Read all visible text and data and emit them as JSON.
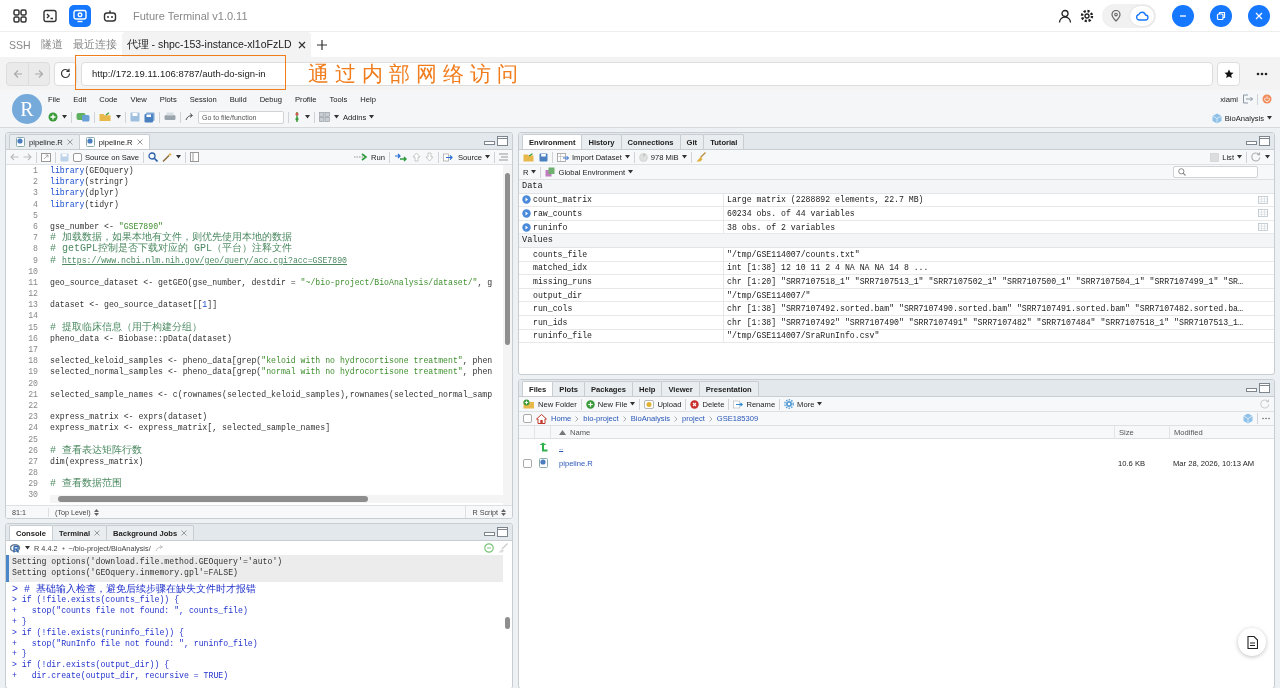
{
  "app": {
    "nav_icons": [
      {
        "kind": "grid",
        "selected": false
      },
      {
        "kind": "terminal",
        "selected": false
      },
      {
        "kind": "monitor",
        "selected": true
      },
      {
        "kind": "robot",
        "selected": false
      }
    ],
    "title": "Future Terminal v1.0.11",
    "mode_toggle": [
      {
        "kind": "pin",
        "selected": false
      },
      {
        "kind": "cloud",
        "selected": true
      }
    ]
  },
  "tabs": [
    {
      "label": "SSH",
      "selected": false,
      "closable": false
    },
    {
      "label": "隧道",
      "selected": false,
      "closable": false
    },
    {
      "label": "最近连接",
      "selected": false,
      "closable": false
    },
    {
      "label": "代理 - shpc-153-instance-xl1oFzLD",
      "selected": true,
      "closable": true
    }
  ],
  "address": {
    "url": "http://172.19.11.106:8787/auth-do-sign-in"
  },
  "annotation": {
    "text": "通过内部网络访问"
  },
  "rstudio": {
    "logo": "R",
    "menu": [
      "File",
      "Edit",
      "Code",
      "View",
      "Plots",
      "Session",
      "Build",
      "Debug",
      "Profile",
      "Tools",
      "Help"
    ],
    "goto_placeholder": "Go to file/function",
    "addins": "Addins",
    "user": "xiami",
    "project": "BioAnalysis"
  },
  "editor": {
    "tabs": [
      {
        "label": "pipeline.R",
        "selected": false
      },
      {
        "label": "pipeline.R",
        "selected": true
      }
    ],
    "source_on_save": {
      "label": "Source on Save",
      "checked": false
    },
    "run": "Run",
    "source": "Source",
    "lines": [
      {
        "n": "1",
        "segs": [
          {
            "kind": "fn",
            "text": "library"
          },
          {
            "kind": "plain",
            "text": "(GEOquery)"
          }
        ]
      },
      {
        "n": "2",
        "segs": [
          {
            "kind": "fn",
            "text": "library"
          },
          {
            "kind": "plain",
            "text": "(stringr)"
          }
        ]
      },
      {
        "n": "3",
        "segs": [
          {
            "kind": "fn",
            "text": "library"
          },
          {
            "kind": "plain",
            "text": "(dplyr)"
          }
        ]
      },
      {
        "n": "4",
        "segs": [
          {
            "kind": "fn",
            "text": "library"
          },
          {
            "kind": "plain",
            "text": "(tidyr)"
          }
        ]
      },
      {
        "n": "5"
      },
      {
        "n": "6",
        "segs": [
          {
            "kind": "plain",
            "text": "gse_number <- "
          },
          {
            "kind": "string",
            "text": "\"GSE7890\""
          }
        ]
      },
      {
        "n": "7",
        "segs": [
          {
            "kind": "comment",
            "text": "# 加载数据，如果本地有文件，则优先使用本地的数据"
          }
        ]
      },
      {
        "n": "8",
        "segs": [
          {
            "kind": "comment",
            "text": "# getGPL控制是否下载对应的 GPL（平台）注释文件"
          }
        ]
      },
      {
        "n": "9",
        "segs": [
          {
            "kind": "comment",
            "text": "# "
          },
          {
            "kind": "link",
            "text": "https://www.ncbi.nlm.nih.gov/geo/query/acc.cgi?acc=GSE7890"
          }
        ]
      },
      {
        "n": "10"
      },
      {
        "n": "11",
        "segs": [
          {
            "kind": "plain",
            "text": "geo_source_dataset <- getGEO(gse_number, destdir = "
          },
          {
            "kind": "string",
            "text": "\"~/bio-project/BioAnalysis/dataset/\""
          },
          {
            "kind": "plain",
            "text": ", g"
          }
        ]
      },
      {
        "n": "12"
      },
      {
        "n": "13",
        "segs": [
          {
            "kind": "plain",
            "text": "dataset <- geo_source_dataset[["
          },
          {
            "kind": "number",
            "text": "1"
          },
          {
            "kind": "plain",
            "text": "]]"
          }
        ]
      },
      {
        "n": "14"
      },
      {
        "n": "15",
        "segs": [
          {
            "kind": "comment",
            "text": "# 提取临床信息（用于构建分组）"
          }
        ]
      },
      {
        "n": "16",
        "segs": [
          {
            "kind": "plain",
            "text": "pheno_data <- Biobase::pData(dataset)"
          }
        ]
      },
      {
        "n": "17"
      },
      {
        "n": "18",
        "segs": [
          {
            "kind": "plain",
            "text": "selected_keloid_samples <- pheno_data[grep("
          },
          {
            "kind": "string",
            "text": "\"keloid with no hydrocortisone treatment\""
          },
          {
            "kind": "plain",
            "text": ", phen"
          }
        ]
      },
      {
        "n": "19",
        "segs": [
          {
            "kind": "plain",
            "text": "selected_normal_samples <- pheno_data[grep("
          },
          {
            "kind": "string",
            "text": "\"normal with no hydrocortisone treatment\""
          },
          {
            "kind": "plain",
            "text": ", phen"
          }
        ]
      },
      {
        "n": "20"
      },
      {
        "n": "21",
        "segs": [
          {
            "kind": "plain",
            "text": "selected_sample_names <- c(rownames(selected_keloid_samples),rownames(selected_normal_samp"
          }
        ]
      },
      {
        "n": "22"
      },
      {
        "n": "23",
        "segs": [
          {
            "kind": "plain",
            "text": "express_matrix <- exprs(dataset)"
          }
        ]
      },
      {
        "n": "24",
        "segs": [
          {
            "kind": "plain",
            "text": "express_matrix <- express_matrix[, selected_sample_names]"
          }
        ]
      },
      {
        "n": "25"
      },
      {
        "n": "26",
        "segs": [
          {
            "kind": "comment",
            "text": "# 查看表达矩阵行数"
          }
        ]
      },
      {
        "n": "27",
        "segs": [
          {
            "kind": "plain",
            "text": "dim(express_matrix)"
          }
        ]
      },
      {
        "n": "28"
      },
      {
        "n": "29",
        "segs": [
          {
            "kind": "comment",
            "text": "# 查看数据范围"
          }
        ]
      },
      {
        "n": "30"
      }
    ],
    "status": {
      "position": "81:1",
      "scope": "(Top Level)",
      "type": "R Script"
    }
  },
  "console": {
    "tabs": [
      {
        "label": "Console",
        "selected": true,
        "closable": false
      },
      {
        "label": "Terminal",
        "selected": false,
        "closable": true
      },
      {
        "label": "Background Jobs",
        "selected": false,
        "closable": true
      }
    ],
    "version": "R 4.4.2",
    "path": "~/bio-project/BioAnalysis/",
    "lines": [
      {
        "kind": "output",
        "text": "Setting options('download.file.method.GEOquery'='auto')"
      },
      {
        "kind": "output",
        "text": "Setting options('GEOquery.inmemory.gpl'=FALSE)"
      },
      {
        "kind": "comment",
        "text": "> # 基础输入检查，避免后续步骤在缺失文件时才报错"
      },
      {
        "kind": "input",
        "text": "> if (!file.exists(counts_file)) {"
      },
      {
        "kind": "input",
        "text": "+   stop(\"counts file not found: \", counts_file)"
      },
      {
        "kind": "input",
        "text": "+ }"
      },
      {
        "kind": "input",
        "text": "> if (!file.exists(runinfo_file)) {"
      },
      {
        "kind": "input",
        "text": "+   stop(\"RunInfo file not found: \", runinfo_file)"
      },
      {
        "kind": "input",
        "text": "+ }"
      },
      {
        "kind": "input",
        "text": "> if (!dir.exists(output_dir)) {"
      },
      {
        "kind": "input",
        "text": "+   dir.create(output_dir, recursive = TRUE)"
      }
    ]
  },
  "environment": {
    "tabs": [
      {
        "label": "Environment",
        "selected": true
      },
      {
        "label": "History",
        "selected": false
      },
      {
        "label": "Connections",
        "selected": false
      },
      {
        "label": "Git",
        "selected": false
      },
      {
        "label": "Tutorial",
        "selected": false
      }
    ],
    "import": "Import Dataset",
    "memory": "978 MiB",
    "view": "List",
    "language": "R",
    "scope": "Global Environment",
    "sections": [
      {
        "title": "Data",
        "rows": [
          {
            "kind": "data",
            "name": "count_matrix",
            "value": "Large matrix (2288892 elements, 22.7 MB)"
          },
          {
            "kind": "data",
            "name": "raw_counts",
            "value": "60234 obs. of 44 variables"
          },
          {
            "kind": "data",
            "name": "runinfo",
            "value": "38 obs. of 2 variables"
          }
        ]
      },
      {
        "title": "Values",
        "rows": [
          {
            "kind": "value",
            "name": "counts_file",
            "value": "\"/tmp/GSE114007/counts.txt\""
          },
          {
            "kind": "value",
            "name": "matched_idx",
            "value": "int [1:38] 12 10 11 2 4 NA NA NA 14 8 ..."
          },
          {
            "kind": "value",
            "name": "missing_runs",
            "value": "chr [1:20] \"SRR7107518_1\" \"SRR7107513_1\" \"SRR7107502_1\" \"SRR7107500_1\" \"SRR7107504_1\" \"SRR7107499_1\" \"SR…"
          },
          {
            "kind": "value",
            "name": "output_dir",
            "value": "\"/tmp/GSE114007/\""
          },
          {
            "kind": "value",
            "name": "run_cols",
            "value": "chr [1:38] \"SRR7107492.sorted.bam\" \"SRR7107490.sorted.bam\" \"SRR7107491.sorted.bam\" \"SRR7107482.sorted.ba…"
          },
          {
            "kind": "value",
            "name": "run_ids",
            "value": "chr [1:38] \"SRR7107492\" \"SRR7107490\" \"SRR7107491\" \"SRR7107482\" \"SRR7107484\" \"SRR7107518_1\" \"SRR7107513_1…"
          },
          {
            "kind": "value",
            "name": "runinfo_file",
            "value": "\"/tmp/GSE114007/SraRunInfo.csv\""
          }
        ]
      }
    ]
  },
  "files": {
    "tabs": [
      {
        "label": "Files",
        "selected": true
      },
      {
        "label": "Plots",
        "selected": false
      },
      {
        "label": "Packages",
        "selected": false
      },
      {
        "label": "Help",
        "selected": false
      },
      {
        "label": "Viewer",
        "selected": false
      },
      {
        "label": "Presentation",
        "selected": false
      }
    ],
    "toolbar": [
      {
        "kind": "new_folder",
        "label": "New Folder"
      },
      {
        "kind": "new_file",
        "label": "New File"
      },
      {
        "kind": "upload",
        "label": "Upload"
      },
      {
        "kind": "delete",
        "label": "Delete"
      },
      {
        "kind": "rename",
        "label": "Rename"
      },
      {
        "kind": "more",
        "label": "More"
      }
    ],
    "select_all_checked": false,
    "breadcrumb": [
      "Home",
      "bio-project",
      "BioAnalysis",
      "project",
      "GSE185309"
    ],
    "columns": [
      "Name",
      "Size",
      "Modified"
    ],
    "rows": [
      {
        "kind": "parent",
        "name": ".."
      },
      {
        "kind": "file",
        "name": "pipeline.R",
        "size": "10.6 KB",
        "modified": "Mar 28, 2026, 10:13 AM",
        "checked": false
      }
    ]
  }
}
